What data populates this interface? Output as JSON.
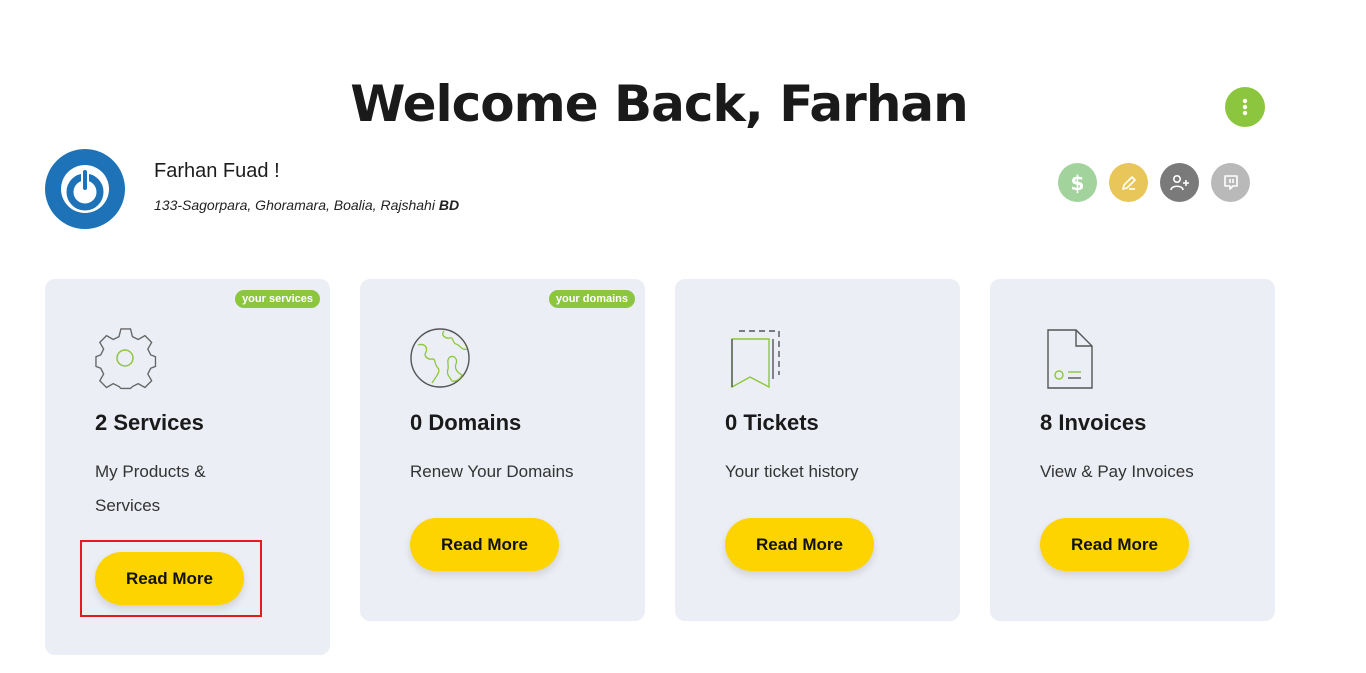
{
  "header": {
    "title": "Welcome Back, Farhan"
  },
  "menu": {
    "icon": "more-vertical-icon"
  },
  "user": {
    "name": "Farhan Fuad !",
    "address": "133-Sagorpara, Ghoramara, Boalia, Rajshahi",
    "country": "BD",
    "avatar_icon": "power-logo-icon"
  },
  "actions": [
    {
      "name": "billing",
      "icon": "dollar-icon",
      "color": "#a2d39c"
    },
    {
      "name": "edit",
      "icon": "pencil-icon",
      "color": "#e8c65a"
    },
    {
      "name": "add-contact",
      "icon": "user-plus-icon",
      "color": "#7a7a7a"
    },
    {
      "name": "chat",
      "icon": "message-icon",
      "color": "#b9b9b9"
    }
  ],
  "cards": [
    {
      "badge": "your services",
      "title": "2 Services",
      "desc_line1": "My Products &",
      "desc_line2": "Services",
      "button": "Read More",
      "icon": "gear-icon"
    },
    {
      "badge": "your domains",
      "title": "0 Domains",
      "desc_line1": "Renew Your Domains",
      "desc_line2": "",
      "button": "Read More",
      "icon": "globe-icon"
    },
    {
      "badge": "",
      "title": "0 Tickets",
      "desc_line1": "Your ticket history",
      "desc_line2": "",
      "button": "Read More",
      "icon": "ticket-icon"
    },
    {
      "badge": "",
      "title": "8 Invoices",
      "desc_line1": "View & Pay Invoices",
      "desc_line2": "",
      "button": "Read More",
      "icon": "invoice-icon"
    }
  ],
  "colors": {
    "accent": "#8cc63f",
    "button": "#fdd400",
    "card_bg": "#eceef5",
    "highlight": "#e31b1b"
  }
}
